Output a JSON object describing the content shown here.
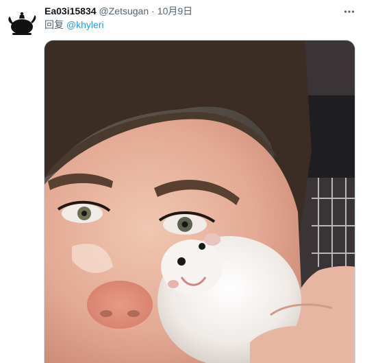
{
  "tweet": {
    "display_name": "Ea03i15834",
    "handle": "@Zetsugan",
    "separator": "·",
    "timestamp": "10月9日",
    "reply_prefix": "回复 ",
    "reply_to": "@khyleri"
  },
  "icons": {
    "avatar": "teapot-silhouette-icon",
    "more": "more-horizontal-icon"
  },
  "colors": {
    "text_primary": "#0f1419",
    "text_secondary": "#536471",
    "link": "#1d9bf0"
  }
}
